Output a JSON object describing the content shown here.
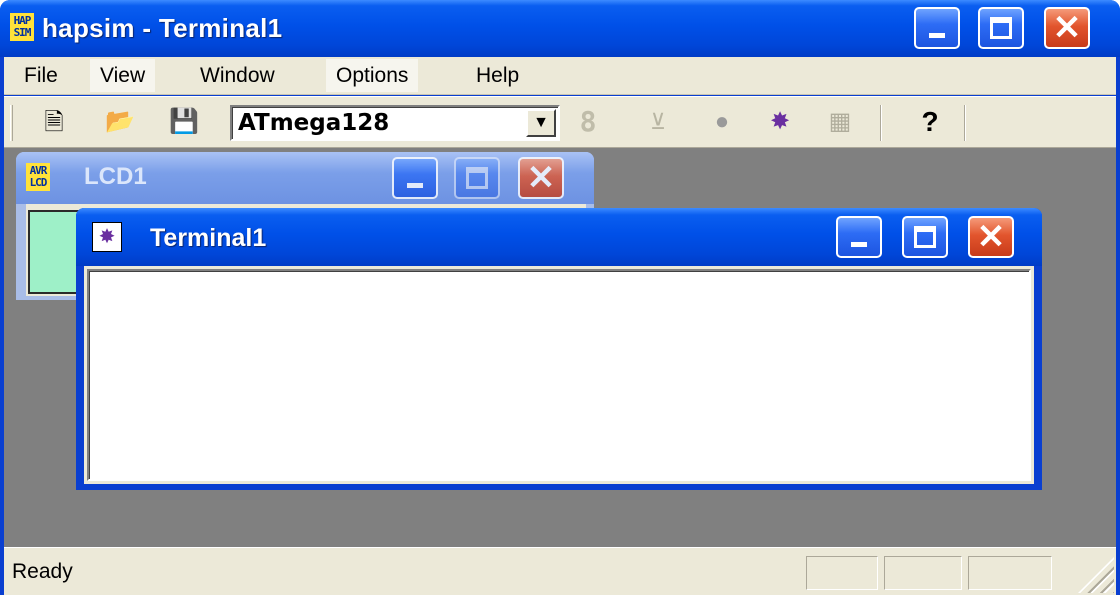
{
  "app": {
    "title": "hapsim - Terminal1",
    "icon": "hapsim-app-icon",
    "icon_text": "HAP SIM"
  },
  "menu": {
    "items": [
      {
        "label": "File"
      },
      {
        "label": "View"
      },
      {
        "label": "Window"
      },
      {
        "label": "Options"
      },
      {
        "label": "Help"
      }
    ]
  },
  "toolbar": {
    "device_select": {
      "value": "ATmega128"
    },
    "icons": [
      "new-icon",
      "open-folder-icon",
      "save-icon",
      "seven-segment-icon",
      "down-arrow-icon",
      "led-icon",
      "hapsim-terminal-icon",
      "keypad-grid-icon",
      "help-icon"
    ]
  },
  "lcd_window": {
    "title": "LCD1",
    "icon_text": "AVR LCD",
    "icon": "avr-lcd-icon"
  },
  "terminal_window": {
    "title": "Terminal1",
    "icon": "terminal-icon",
    "content": ""
  },
  "status_bar": {
    "text": "Ready"
  },
  "colors": {
    "title_blue": "#0050e8",
    "close_red": "#e2552d",
    "face": "#ece9d8",
    "mdi_background": "#808080",
    "lcd_screen": "#9ef0c8"
  }
}
